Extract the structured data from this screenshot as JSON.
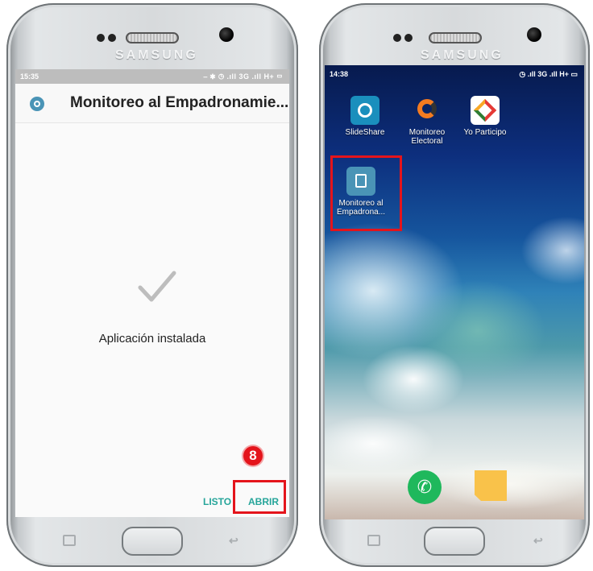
{
  "brand": "SAMSUNG",
  "left_screen": {
    "status_time": "15:35",
    "status_icons": "⎯ ✱ ◷ .ıll 3G .ıll H+ ▭",
    "app_title": "Monitoreo al Empadronamie...",
    "message": "Aplicación instalada",
    "buttons": {
      "done": "LISTO",
      "open": "ABRIR"
    },
    "step_number": "8"
  },
  "right_screen": {
    "status_time": "14:38",
    "status_icons": "◷ .ıll 3G .ıll H+ ▭",
    "apps": [
      {
        "label": "SlideShare",
        "icon": "slideshare-icon"
      },
      {
        "label": "Monitoreo Electoral",
        "icon": "monitoreo-electoral-icon"
      },
      {
        "label": "Yo Participo",
        "icon": "yo-participo-icon"
      },
      {
        "label": "Monitoreo al Empadrona...",
        "icon": "monitoreo-empadronamiento-icon"
      }
    ],
    "dock": [
      {
        "icon": "phone-icon"
      },
      {
        "icon": "messages-icon"
      }
    ]
  },
  "colors": {
    "accent": "#26a59a",
    "highlight": "#e4141b",
    "app_icon": "#4a94b6"
  }
}
